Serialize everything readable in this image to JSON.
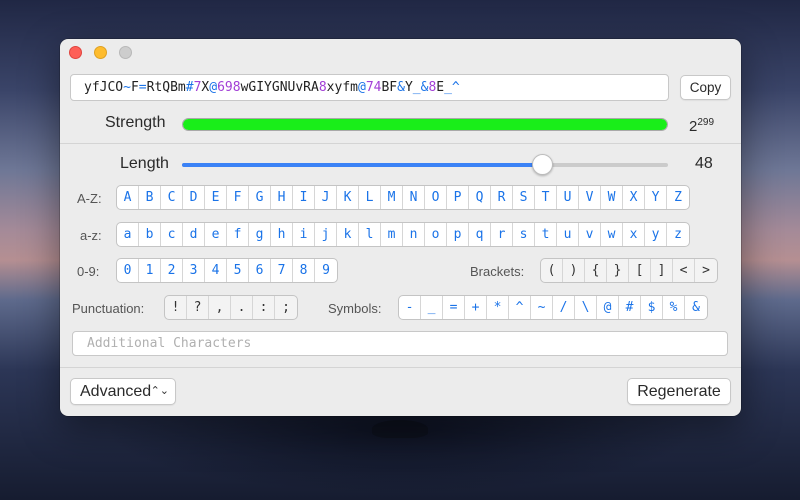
{
  "password": {
    "segments": [
      {
        "text": "yfJCO",
        "type": "letter"
      },
      {
        "text": "~",
        "type": "symbol"
      },
      {
        "text": "F",
        "type": "letter"
      },
      {
        "text": "=",
        "type": "symbol"
      },
      {
        "text": "RtQBm",
        "type": "letter"
      },
      {
        "text": "#",
        "type": "symbol"
      },
      {
        "text": "7",
        "type": "digit"
      },
      {
        "text": "X",
        "type": "letter"
      },
      {
        "text": "@",
        "type": "symbol"
      },
      {
        "text": "698",
        "type": "digit"
      },
      {
        "text": "wGIYGNUvRA",
        "type": "letter"
      },
      {
        "text": "8",
        "type": "digit"
      },
      {
        "text": "xyfm",
        "type": "letter"
      },
      {
        "text": "@",
        "type": "symbol"
      },
      {
        "text": "74",
        "type": "digit"
      },
      {
        "text": "BF",
        "type": "letter"
      },
      {
        "text": "&",
        "type": "symbol"
      },
      {
        "text": "Y",
        "type": "letter"
      },
      {
        "text": "_&",
        "type": "symbol"
      },
      {
        "text": "8",
        "type": "digit"
      },
      {
        "text": "E",
        "type": "letter"
      },
      {
        "text": "_^",
        "type": "symbol"
      }
    ],
    "copy_label": "Copy"
  },
  "strength": {
    "label": "Strength",
    "fill_percent": 100,
    "value_base": "2",
    "value_exp": "299"
  },
  "length": {
    "label": "Length",
    "value": "48",
    "slider_fraction": 0.74
  },
  "rows": {
    "upper": {
      "label": "A-Z:",
      "keys": [
        "A",
        "B",
        "C",
        "D",
        "E",
        "F",
        "G",
        "H",
        "I",
        "J",
        "K",
        "L",
        "M",
        "N",
        "O",
        "P",
        "Q",
        "R",
        "S",
        "T",
        "U",
        "V",
        "W",
        "X",
        "Y",
        "Z"
      ]
    },
    "lower": {
      "label": "a-z:",
      "keys": [
        "a",
        "b",
        "c",
        "d",
        "e",
        "f",
        "g",
        "h",
        "i",
        "j",
        "k",
        "l",
        "m",
        "n",
        "o",
        "p",
        "q",
        "r",
        "s",
        "t",
        "u",
        "v",
        "w",
        "x",
        "y",
        "z"
      ]
    },
    "digits": {
      "label": "0-9:",
      "keys": [
        "0",
        "1",
        "2",
        "3",
        "4",
        "5",
        "6",
        "7",
        "8",
        "9"
      ]
    },
    "brackets": {
      "label": "Brackets:",
      "keys": [
        "(",
        ")",
        "{",
        "}",
        "[",
        "]",
        "<",
        ">"
      ]
    },
    "punctuation": {
      "label": "Punctuation:",
      "keys": [
        "!",
        "?",
        ",",
        ".",
        ":",
        ";"
      ]
    },
    "symbols": {
      "label": "Symbols:",
      "keys": [
        "-",
        "_",
        "=",
        "+",
        "*",
        "^",
        "~",
        "/",
        "\\",
        "@",
        "#",
        "$",
        "%",
        "&"
      ]
    }
  },
  "additional": {
    "placeholder": "Additional Characters"
  },
  "footer": {
    "advanced_label": "Advanced",
    "regenerate_label": "Regenerate"
  },
  "colors": {
    "letter": "#222222",
    "digit": "#a23fd6",
    "symbol": "#1a73e8",
    "enabled_key": "#1a73e8",
    "strength_fill": "#19ee19",
    "slider_fill": "#3b82f6"
  }
}
